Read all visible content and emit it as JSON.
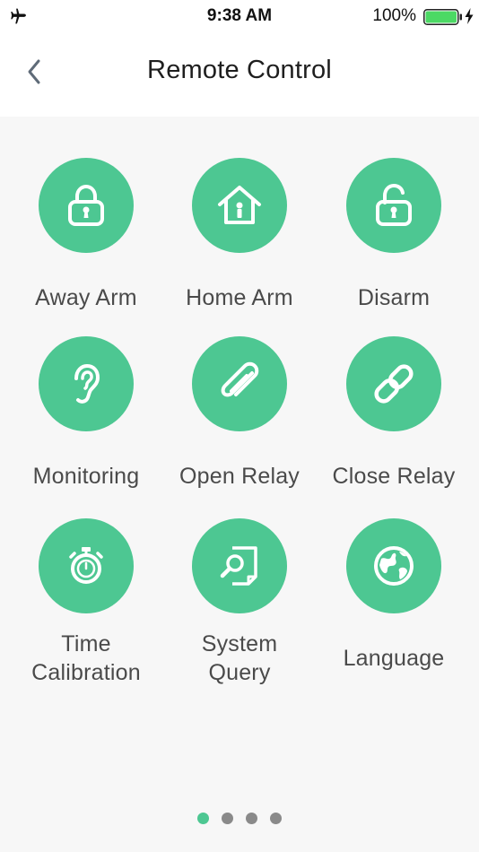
{
  "status_bar": {
    "time": "9:38 AM",
    "battery_percent": "100%",
    "battery_level": 1.0,
    "battery_color": "#4cd964",
    "airplane_icon": "airplane-icon",
    "charging_icon": "charging-bolt-icon"
  },
  "nav": {
    "title": "Remote Control",
    "back_icon": "chevron-left-icon"
  },
  "accent_color": "#4dc792",
  "tiles": [
    {
      "label": "Away Arm",
      "icon": "lock-icon"
    },
    {
      "label": "Home Arm",
      "icon": "house-lock-icon"
    },
    {
      "label": "Disarm",
      "icon": "unlock-icon"
    },
    {
      "label": "Monitoring",
      "icon": "ear-icon"
    },
    {
      "label": "Open Relay",
      "icon": "paperclip-icon"
    },
    {
      "label": "Close Relay",
      "icon": "link-icon"
    },
    {
      "label": "Time\nCalibration",
      "icon": "stopwatch-icon"
    },
    {
      "label": "System\nQuery",
      "icon": "document-search-icon"
    },
    {
      "label": "Language",
      "icon": "globe-icon"
    }
  ],
  "pagination": {
    "total": 4,
    "current": 1
  }
}
